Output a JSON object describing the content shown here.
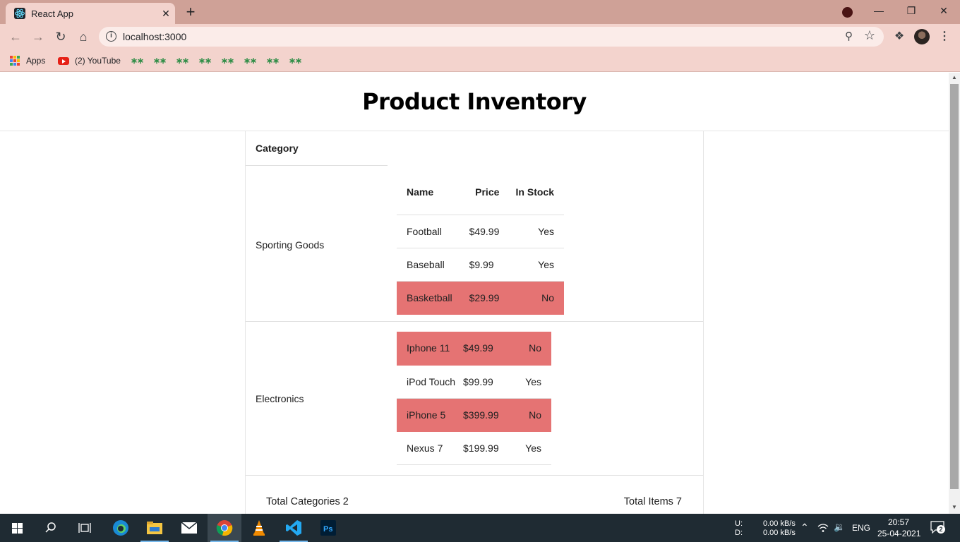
{
  "browser": {
    "tab_title": "React App",
    "tab_close": "✕",
    "new_tab": "+",
    "url": "localhost:3000",
    "bookmarks": {
      "apps": "Apps",
      "youtube": "(2) YouTube",
      "gfg_count": 8
    }
  },
  "page": {
    "title": "Product Inventory",
    "category_header": "Category",
    "columns": {
      "name": "Name",
      "price": "Price",
      "stock": "In Stock"
    },
    "categories": [
      {
        "name": "Sporting Goods",
        "products": [
          {
            "name": "Football",
            "price": "$49.99",
            "stock": "Yes",
            "out_of_stock": false
          },
          {
            "name": "Baseball",
            "price": "$9.99",
            "stock": "Yes",
            "out_of_stock": false
          },
          {
            "name": "Basketball",
            "price": "$29.99",
            "stock": "No",
            "out_of_stock": true
          }
        ]
      },
      {
        "name": "Electronics",
        "products": [
          {
            "name": "Iphone 11",
            "price": "$49.99",
            "stock": "No",
            "out_of_stock": true
          },
          {
            "name": "iPod Touch",
            "price": "$99.99",
            "stock": "Yes",
            "out_of_stock": false
          },
          {
            "name": "iPhone 5",
            "price": "$399.99",
            "stock": "No",
            "out_of_stock": true
          },
          {
            "name": "Nexus 7",
            "price": "$199.99",
            "stock": "Yes",
            "out_of_stock": false
          }
        ]
      }
    ],
    "footer": {
      "total_categories": "Total Categories 2",
      "total_items": "Total Items 7"
    }
  },
  "taskbar": {
    "net_up_label": "U:",
    "net_down_label": "D:",
    "net_up": "0.00 kB/s",
    "net_down": "0.00 kB/s",
    "lang": "ENG",
    "time": "20:57",
    "date": "25-04-2021",
    "notifications": "2"
  },
  "colors": {
    "out_of_stock_row": "#e57373",
    "tab_strip": "#cfa197",
    "toolbar": "#f3d3cd"
  }
}
